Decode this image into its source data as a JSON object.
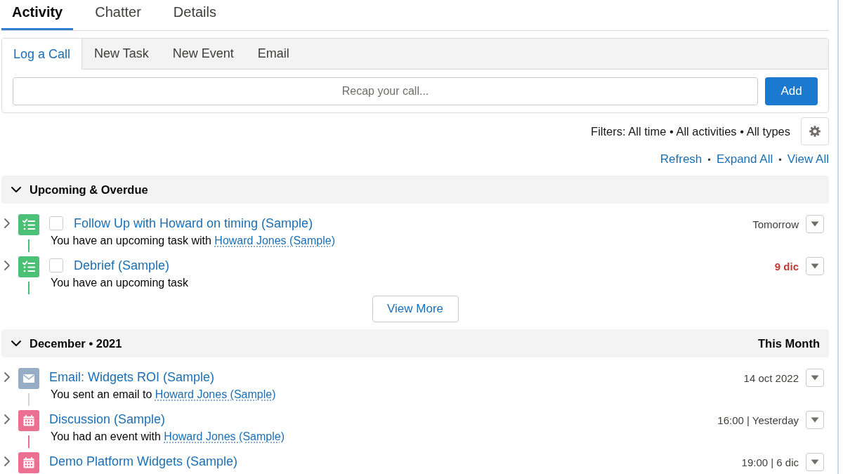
{
  "tabs": [
    {
      "label": "Activity",
      "selected": true
    },
    {
      "label": "Chatter",
      "selected": false
    },
    {
      "label": "Details",
      "selected": false
    }
  ],
  "composer": {
    "tabs": [
      {
        "label": "Log a Call",
        "selected": true
      },
      {
        "label": "New Task",
        "selected": false
      },
      {
        "label": "New Event",
        "selected": false
      },
      {
        "label": "Email",
        "selected": false
      }
    ],
    "input": {
      "placeholder": "Recap your call..."
    },
    "button": "Add"
  },
  "filters": "Filters: All time • All activities • All types",
  "links": {
    "items": [
      "Refresh",
      "Expand All",
      "View All"
    ],
    "separator": "•"
  },
  "sections": [
    {
      "title": "Upcoming & Overdue",
      "expanded": true,
      "items": [
        {
          "kind": "task",
          "expanded": false,
          "checked": false,
          "title": "Follow Up with Howard on timing (Sample)",
          "description": "You have an upcoming task with",
          "contact": "Howard Jones (Sample)",
          "date": "Tomorrow",
          "overdue": false
        },
        {
          "kind": "task",
          "expanded": false,
          "checked": false,
          "title": "Debrief (Sample)",
          "description": "You have an upcoming task",
          "date": "9 dic",
          "overdue": true
        }
      ],
      "more_button": "View More"
    },
    {
      "title": "December • 2021",
      "period": "This Month",
      "expanded": true,
      "items": [
        {
          "kind": "email",
          "expanded": false,
          "title": "Email: Widgets ROI (Sample)",
          "description": "You sent an email to",
          "contact": "Howard Jones (Sample)",
          "date": "14 oct 2022",
          "overdue": false
        },
        {
          "kind": "event",
          "expanded": false,
          "title": "Discussion (Sample)",
          "description": "You had an event with",
          "contact": "Howard Jones (Sample)",
          "date": "16:00 | Yesterday",
          "overdue": false
        },
        {
          "kind": "event",
          "expanded": false,
          "title": "Demo Platform Widgets (Sample)",
          "date": "19:00 | 6 dic",
          "overdue": false
        }
      ]
    }
  ]
}
